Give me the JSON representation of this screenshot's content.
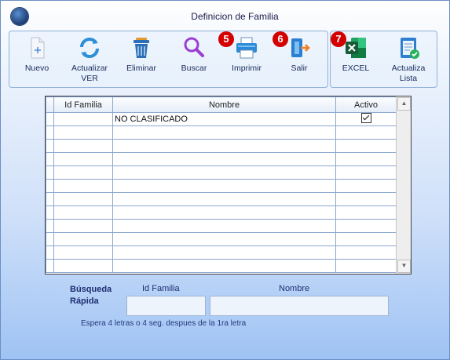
{
  "window": {
    "title": "Definicion de Familia"
  },
  "toolbar": {
    "nuevo": "Nuevo",
    "actualizar_line1": "Actualizar",
    "actualizar_line2": "VER",
    "eliminar": "Eliminar",
    "buscar": "Buscar",
    "imprimir": "Imprimir",
    "salir": "Salir",
    "excel": "EXCEL",
    "actualiza_line1": "Actualiza",
    "actualiza_line2": "Lista",
    "badges": {
      "imprimir": "5",
      "salir": "6",
      "excel": "7"
    }
  },
  "grid": {
    "headers": {
      "id": "Id Familia",
      "nombre": "Nombre",
      "activo": "Activo"
    },
    "rows": [
      {
        "id": "",
        "nombre": "NO CLASIFICADO",
        "activo": true
      }
    ]
  },
  "search": {
    "title_line1": "Búsqueda",
    "title_line2": "Rápida",
    "id_label": "Id Familia",
    "nombre_label": "Nombre",
    "id_value": "",
    "nombre_value": "",
    "hint": "Espera 4 letras o 4 seg. despues de la 1ra letra"
  },
  "colors": {
    "accent": "#1e2e70",
    "badge": "#d40000",
    "excel": "#1e7145"
  }
}
